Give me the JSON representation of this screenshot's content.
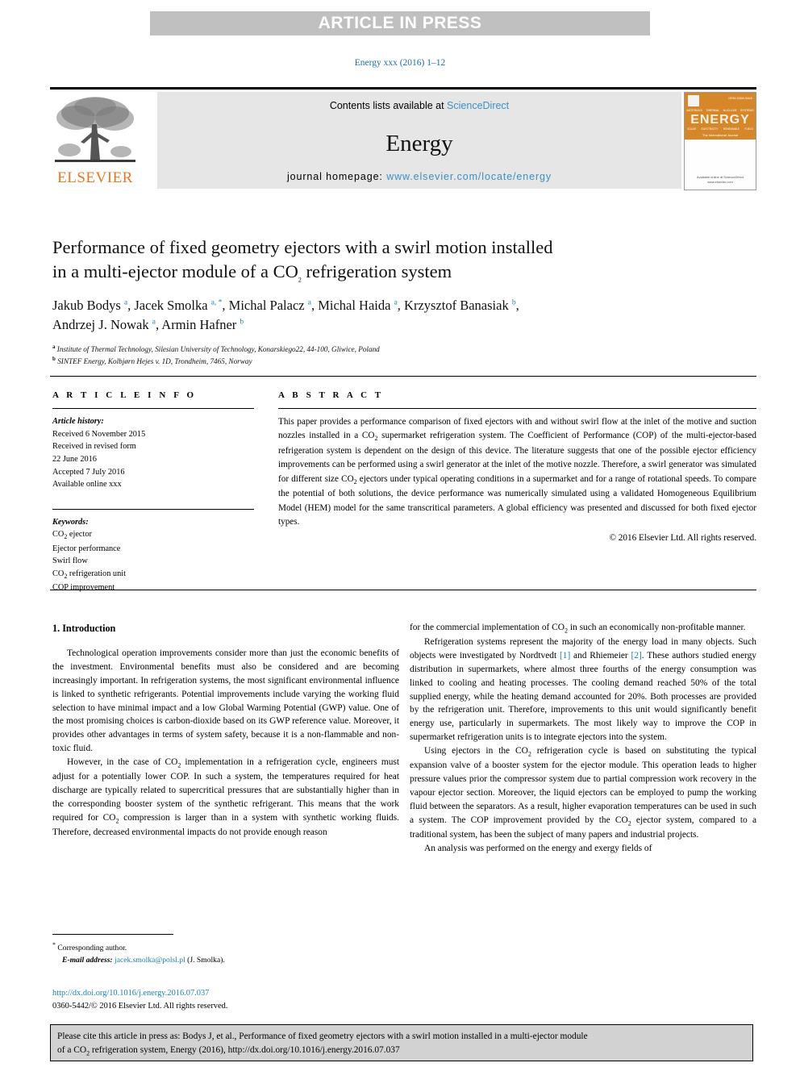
{
  "banner": {
    "press_label": "ARTICLE IN PRESS"
  },
  "running_head": "Energy xxx (2016) 1–12",
  "masthead": {
    "contents_prefix": "Contents lists available at ",
    "sciencedirect": "ScienceDirect",
    "journal_title": "Energy",
    "homepage_prefix": "journal homepage: ",
    "homepage_url": "www.elsevier.com/locate/energy",
    "elsevier_wordmark": "ELSEVIER",
    "cover": {
      "title": "ENERGY",
      "tagline": "The International Journal",
      "issn": "ISSN 0360-5442",
      "top_labels": [
        "MATERIALS",
        "THERMAL",
        "NUCLEAR",
        "SYSTEMS"
      ],
      "bottom_labels": [
        "SOLAR",
        "ELECTRICITY",
        "RENEWABLE",
        "FUELS"
      ],
      "publisher": "Available online at\nScienceDirect\nwww.elsevier.com"
    }
  },
  "article": {
    "title_line1": "Performance of fixed geometry ejectors with a swirl motion installed",
    "title_line2_a": "in a multi-ejector module of a CO",
    "title_line2_sub": "2",
    "title_line2_b": " refrigeration system",
    "authors": [
      {
        "name": "Jakub Bodys",
        "marks": "a"
      },
      {
        "name": "Jacek Smolka",
        "marks": "a, *"
      },
      {
        "name": "Michal Palacz",
        "marks": "a"
      },
      {
        "name": "Michal Haida",
        "marks": "a"
      },
      {
        "name": "Krzysztof Banasiak",
        "marks": "b"
      },
      {
        "name": "Andrzej J. Nowak",
        "marks": "a"
      },
      {
        "name": "Armin Hafner",
        "marks": "b"
      }
    ],
    "affiliations": [
      {
        "mark": "a",
        "text": "Institute of Thermal Technology, Silesian University of Technology, Konarskiego22, 44-100, Gliwice, Poland"
      },
      {
        "mark": "b",
        "text": "SINTEF Energy, Kolbjørn Hejes v. 1D, Trondheim, 7465, Norway"
      }
    ]
  },
  "article_info": {
    "heading": "A R T I C L E  I N F O",
    "history_label": "Article history:",
    "history_lines": [
      "Received 6 November 2015",
      "Received in revised form",
      "22 June 2016",
      "Accepted 7 July 2016",
      "Available online xxx"
    ],
    "keywords_label": "Keywords:",
    "keywords": [
      "CO2 ejector",
      "Ejector performance",
      "Swirl flow",
      "CO2 refrigeration unit",
      "COP improvement"
    ]
  },
  "abstract": {
    "heading": "A B S T R A C T",
    "text": "This paper provides a performance comparison of fixed ejectors with and without swirl flow at the inlet of the motive and suction nozzles installed in a CO2 supermarket refrigeration system. The Coefficient of Performance (COP) of the multi-ejector-based refrigeration system is dependent on the design of this device. The literature suggests that one of the possible ejector efficiency improvements can be performed using a swirl generator at the inlet of the motive nozzle. Therefore, a swirl generator was simulated for different size CO2 ejectors under typical operating conditions in a supermarket and for a range of rotational speeds. To compare the potential of both solutions, the device performance was numerically simulated using a validated Homogeneous Equilibrium Model (HEM) model for the same transcritical parameters. A global efficiency was presented and discussed for both fixed ejector types.",
    "copyright": "© 2016 Elsevier Ltd. All rights reserved."
  },
  "body": {
    "section_heading": "1. Introduction",
    "left_paragraphs": [
      "Technological operation improvements consider more than just the economic benefits of the investment. Environmental benefits must also be considered and are becoming increasingly important. In refrigeration systems, the most significant environmental influence is linked to synthetic refrigerants. Potential improvements include varying the working fluid selection to have minimal impact and a low Global Warming Potential (GWP) value. One of the most promising choices is carbon-dioxide based on its GWP reference value. Moreover, it provides other advantages in terms of system safety, because it is a non-flammable and non-toxic fluid.",
      "However, in the case of CO2 implementation in a refrigeration cycle, engineers must adjust for a potentially lower COP. In such a system, the temperatures required for heat discharge are typically related to supercritical pressures that are substantially higher than in the corresponding booster system of the synthetic refrigerant. This means that the work required for CO2 compression is larger than in a system with synthetic working fluids. Therefore, decreased environmental impacts do not provide enough reason"
    ],
    "right_paragraphs": [
      "for the commercial implementation of CO2 in such an economically non-profitable manner.",
      "Refrigeration systems represent the majority of the energy load in many objects. Such objects were investigated by Nordtvedt [1] and Rhiemeier [2]. These authors studied energy distribution in supermarkets, where almost three fourths of the energy consumption was linked to cooling and heating processes. The cooling demand reached 50% of the total supplied energy, while the heating demand accounted for 20%. Both processes are provided by the refrigeration unit. Therefore, improvements to this unit would significantly benefit energy use, particularly in supermarkets. The most likely way to improve the COP in supermarket refrigeration units is to integrate ejectors into the system.",
      "Using ejectors in the CO2 refrigeration cycle is based on substituting the typical expansion valve of a booster system for the ejector module. This operation leads to higher pressure values prior the compressor system due to partial compression work recovery in the vapour ejector section. Moreover, the liquid ejectors can be employed to pump the working fluid between the separators. As a result, higher evaporation temperatures can be used in such a system. The COP improvement provided by the CO2 ejector system, compared to a traditional system, has been the subject of many papers and industrial projects.",
      "An analysis was performed on the energy and exergy fields of"
    ]
  },
  "footnote": {
    "corresponding": "Corresponding author.",
    "email_label": "E-mail address:",
    "email": "jacek.smolka@polsl.pl",
    "email_suffix": "(J. Smolka)."
  },
  "doi": {
    "url": "http://dx.doi.org/10.1016/j.energy.2016.07.037",
    "issn_line": "0360-5442/© 2016 Elsevier Ltd. All rights reserved."
  },
  "citation_box": {
    "line1_a": "Please cite this article in press as: Bodys J, et al., Performance of fixed geometry ejectors with a swirl motion installed in a multi-ejector module",
    "line2_a": "of a CO",
    "line2_sub": "2",
    "line2_b": " refrigeration system, Energy (2016), http://dx.doi.org/10.1016/j.energy.2016.07.037"
  },
  "colors": {
    "link_blue": "#1a7fb5",
    "elsevier_orange": "#e87722",
    "banner_gray": "#c0c0c0",
    "masthead_gray": "#e6e6e6",
    "cite_gray": "#d2d2d2"
  }
}
